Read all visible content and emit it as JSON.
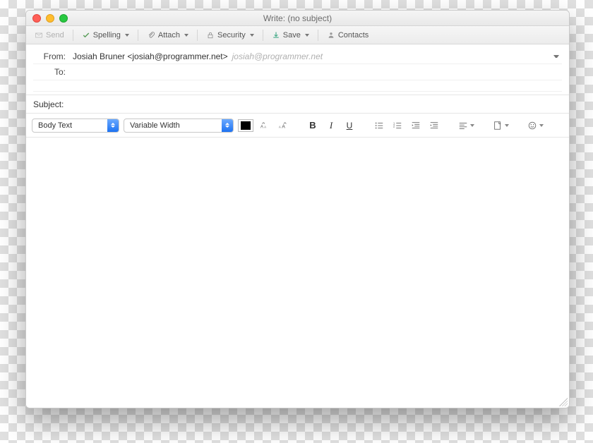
{
  "window": {
    "title": "Write: (no subject)"
  },
  "toolbar": {
    "send": "Send",
    "spelling": "Spelling",
    "attach": "Attach",
    "security": "Security",
    "save": "Save",
    "contacts": "Contacts"
  },
  "headers": {
    "from_label": "From:",
    "from_value": "Josiah Bruner <josiah@programmer.net>",
    "from_hint": "josiah@programmer.net",
    "to_label": "To:",
    "to_value": ""
  },
  "subject": {
    "label": "Subject:",
    "value": ""
  },
  "format": {
    "paragraph": "Body Text",
    "font": "Variable Width",
    "fg_color": "#000000"
  }
}
